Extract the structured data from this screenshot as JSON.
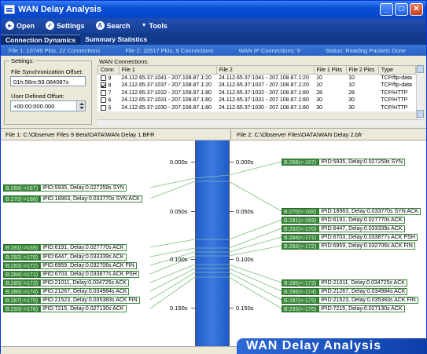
{
  "window": {
    "title": "WAN Delay Analysis"
  },
  "toolbar": {
    "open": "Open",
    "settings": "Settings",
    "search": "Search",
    "tools": "Tools"
  },
  "tabs": [
    {
      "label": "Connection Dynamics"
    },
    {
      "label": "Summary Statistics"
    }
  ],
  "info": {
    "file1": "File 1: 10749 Pkts, 22 Connections",
    "file2": "File 2: 10517 Pkts, 9 Connections",
    "wan": "WAN IP Connections: 9",
    "status": "Status: Reading Packets Done"
  },
  "settings": {
    "title": "Settings:",
    "sync_label": "File Synchronization Offset:",
    "sync_value": "01h:58m:59.084087s",
    "user_label": "User Defined Offset:",
    "user_value": "+00:00:000.000"
  },
  "connections": {
    "title": "WAN Connections:",
    "headers": [
      "Conn",
      "File 1",
      "File 2",
      "File 1 Pkts",
      "File 2 Pkts",
      "Type"
    ],
    "rows": [
      {
        "checked": false,
        "conn": "9",
        "f1": "24.112.65.37:1041 - 207.108.87.1:20",
        "f2": "24.112.65.37:1041 - 207.108.87.1:20",
        "p1": "10",
        "p2": "10",
        "type": "TCP/ftp-data"
      },
      {
        "checked": true,
        "conn": "8",
        "f1": "24.112.65.37:1037 - 207.108.87.1:20",
        "f2": "24.112.65.37:1037 - 207.108.87.1:20",
        "p1": "10",
        "p2": "10",
        "type": "TCP/ftp-data"
      },
      {
        "checked": false,
        "conn": "7",
        "f1": "24.112.65.37:1032 - 207.108.87.1:80",
        "f2": "24.112.65.37:1032 - 207.108.87.1:80",
        "p1": "28",
        "p2": "28",
        "type": "TCP/HTTP"
      },
      {
        "checked": false,
        "conn": "6",
        "f1": "24.112.65.37:1031 - 207.108.87.1:80",
        "f2": "24.112.65.37:1031 - 207.108.87.1:80",
        "p1": "30",
        "p2": "30",
        "type": "TCP/HTTP"
      },
      {
        "checked": false,
        "conn": "5",
        "f1": "24.112.65.37:1030 - 207.108.87.1:80",
        "f2": "24.112.65.37:1030 - 207.108.87.1:80",
        "p1": "30",
        "p2": "30",
        "type": "TCP/HTTP"
      }
    ]
  },
  "files": {
    "file1": "File 1: C:\\Observer Files 9 Beta\\DATA\\WAN Delay 1.BFR",
    "file2": "File 2: C:\\Observer Files\\DATA\\WAN Delay 2.bfr"
  },
  "timeline": {
    "left_ticks": [
      "0.000s",
      "0.050s",
      "0.100s",
      "0.150s"
    ],
    "right_ticks": [
      "0.000s",
      "0.050s",
      "0.100s",
      "0.150s"
    ],
    "left_packets": [
      {
        "id": "B:268(->167)",
        "desc": "IPID:5935, Delay:0.027259s SYN"
      },
      {
        "id": "B:270(->168)",
        "desc": "IPID:18963, Delay:0.033770s SYN ACK"
      },
      {
        "id": "B:281(->169)",
        "desc": "IPID:6191, Delay:0.027770s ACK"
      },
      {
        "id": "B:282(->170)",
        "desc": "IPID:6447, Delay:0.033339s ACK"
      },
      {
        "id": "B:283(->172)",
        "desc": "IPID:6959, Delay:0.032706s ACK FIN"
      },
      {
        "id": "B:284(->171)",
        "desc": "IPID:6703, Delay:0.033877s ACK PSH"
      },
      {
        "id": "B:285(->173)",
        "desc": "IPID:21011, Delay:0.034725s ACK"
      },
      {
        "id": "B:286(->174)",
        "desc": "IPID:21267, Delay:0.034984s ACK"
      },
      {
        "id": "B:287(->175)",
        "desc": "IPID:21523, Delay:0.035383s ACK FIN"
      },
      {
        "id": "B:293(->176)",
        "desc": "IPID:7215, Delay:0.027130s ACK"
      }
    ],
    "right_packets": [
      {
        "id": "B:268(<-167)",
        "desc": "IPID:5935, Delay:0.027259s SYN"
      },
      {
        "id": "B:270(<-168)",
        "desc": "IPID:18963, Delay:0.033770s SYN ACK"
      },
      {
        "id": "B:281(<-169)",
        "desc": "IPID:6191, Delay:0.027770s ACK"
      },
      {
        "id": "B:282(<-170)",
        "desc": "IPID:6447, Delay:0.033339s ACK"
      },
      {
        "id": "B:284(<-171)",
        "desc": "IPID:6703, Delay:0.033877s ACK PSH"
      },
      {
        "id": "B:283(<-172)",
        "desc": "IPID:6959, Delay:0.032706s ACK FIN"
      },
      {
        "id": "B:285(<-173)",
        "desc": "IPID:21011, Delay:0.034725s ACK"
      },
      {
        "id": "B:286(<-174)",
        "desc": "IPID:21267, Delay:0.034984s ACK"
      },
      {
        "id": "B:287(<-175)",
        "desc": "IPID:21523, Delay:0.035383s ACK FIN"
      },
      {
        "id": "B:293(<-176)",
        "desc": "IPID:7215, Delay:0.027130s ACK"
      }
    ]
  },
  "brand": {
    "text": "WAN Delay Analysis"
  }
}
